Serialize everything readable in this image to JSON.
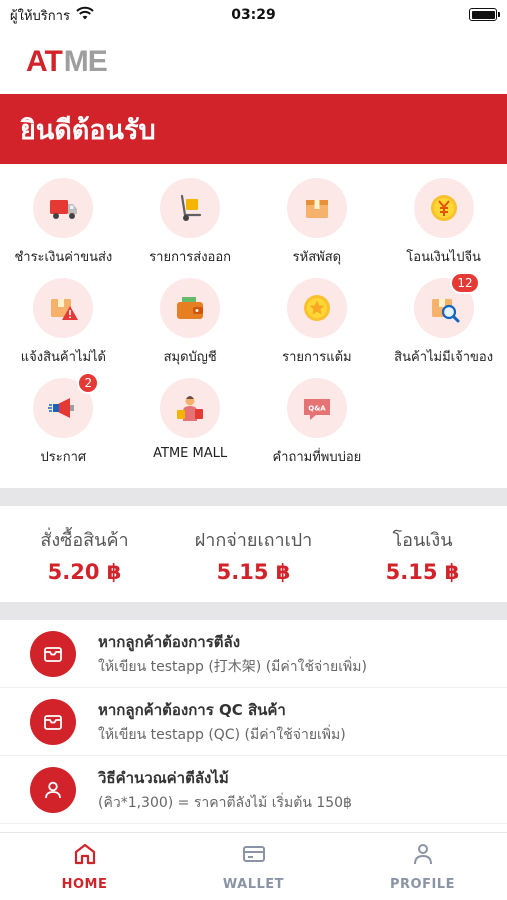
{
  "status_bar": {
    "carrier": "ผู้ให้บริการ",
    "time": "03:29"
  },
  "logo": {
    "text_a": "AT",
    "text_b": "ME"
  },
  "banner": {
    "title": "ยินดีต้อนรับ"
  },
  "menu": [
    {
      "label": "ชำระเงินค่าขนส่ง",
      "icon": "truck-icon"
    },
    {
      "label": "รายการส่งออก",
      "icon": "hand-truck-icon"
    },
    {
      "label": "รหัสพัสดุ",
      "icon": "parcel-box-icon"
    },
    {
      "label": "โอนเงินไปจีน",
      "icon": "yuan-coin-icon"
    },
    {
      "label": "แจ้งสินค้าไม่ได้",
      "icon": "warning-box-icon"
    },
    {
      "label": "สมุดบัญชี",
      "icon": "wallet-icon"
    },
    {
      "label": "รายการแต้ม",
      "icon": "star-coin-icon"
    },
    {
      "label": "สินค้าไม่มีเจ้าของ",
      "icon": "search-box-icon",
      "badge": "12"
    },
    {
      "label": "ประกาศ",
      "icon": "megaphone-icon",
      "badge": "2"
    },
    {
      "label": "ATME MALL",
      "icon": "shopper-icon"
    },
    {
      "label": "คำถามที่พบบ่อย",
      "icon": "qa-bubble-icon"
    }
  ],
  "rates": [
    {
      "label": "สั่งซื้อสินค้า",
      "value": "5.20 ฿"
    },
    {
      "label": "ฝากจ่ายเถาเปา",
      "value": "5.15 ฿"
    },
    {
      "label": "โอนเงิน",
      "value": "5.15 ฿"
    }
  ],
  "notices": [
    {
      "title": "หากลูกค้าต้องการตีลัง",
      "subtitle": "ให้เขียน testapp (打木架) (มีค่าใช้จ่ายเพิ่ม)",
      "icon": "box-icon"
    },
    {
      "title": "หากลูกค้าต้องการ QC สินค้า",
      "subtitle": "ให้เขียน testapp (QC) (มีค่าใช้จ่ายเพิ่ม)",
      "icon": "box-icon"
    },
    {
      "title": "วิธีคำนวณค่าตีลังไม้",
      "subtitle": "(คิว*1,300) = ราคาตีลังไม้ เริ่มต้น 150฿",
      "icon": "person-icon"
    }
  ],
  "tabs": [
    {
      "label": "HOME",
      "icon": "home-icon",
      "active": true
    },
    {
      "label": "WALLET",
      "icon": "wallet-card-icon",
      "active": false
    },
    {
      "label": "PROFILE",
      "icon": "profile-icon",
      "active": false
    }
  ],
  "colors": {
    "brand_red": "#d2232a",
    "icon_bg": "#fde8e8",
    "tab_inactive": "#8a94a6"
  }
}
